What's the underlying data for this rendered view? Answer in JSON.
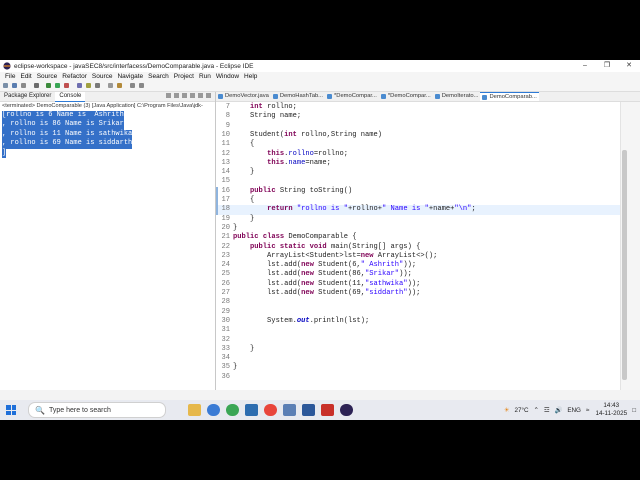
{
  "window": {
    "title": "eclipse-workspace - javaSEC8/src/interfacess/DemoComparable.java - Eclipse IDE",
    "controls": [
      "–",
      "❐",
      "✕"
    ]
  },
  "menu": [
    "File",
    "Edit",
    "Source",
    "Refactor",
    "Source",
    "Navigate",
    "Search",
    "Project",
    "Run",
    "Window",
    "Help"
  ],
  "left_panel": {
    "tabs": [
      "Package Explorer",
      "Console"
    ],
    "console_header": "<terminated> DemoComparable (3) [Java Application] C:\\Program Files\\Java\\jdk-",
    "console_lines": [
      "[rollno is 6 Name is  Ashrith",
      ", rollno is 86 Name is Srikar",
      ", rollno is 11 Name is sathwika",
      ", rollno is 69 Name is siddarth"
    ],
    "console_end": "]"
  },
  "editor_tabs": [
    "DemoVector.java",
    "DemoHashTab...",
    "*DemoCompar...",
    "*DemoCompar...",
    "DemoIterato...",
    "DemoComparab..."
  ],
  "code": {
    "lines": [
      {
        "n": "7",
        "parts": [
          [
            "    ",
            ""
          ],
          [
            "int",
            "kw"
          ],
          [
            " rollno;",
            ""
          ]
        ]
      },
      {
        "n": "8",
        "parts": [
          [
            "    String name;",
            ""
          ]
        ]
      },
      {
        "n": "9",
        "parts": [
          [
            "",
            ""
          ]
        ]
      },
      {
        "n": "10",
        "parts": [
          [
            "    Student(",
            ""
          ],
          [
            "int",
            "kw"
          ],
          [
            " rollno,String name)",
            ""
          ]
        ]
      },
      {
        "n": "11",
        "parts": [
          [
            "    {",
            ""
          ]
        ]
      },
      {
        "n": "12",
        "parts": [
          [
            "        ",
            ""
          ],
          [
            "this",
            "kw"
          ],
          [
            ".",
            ""
          ],
          [
            "rollno",
            "fld"
          ],
          [
            "=rollno;",
            ""
          ]
        ]
      },
      {
        "n": "13",
        "parts": [
          [
            "        ",
            ""
          ],
          [
            "this",
            "kw"
          ],
          [
            ".",
            ""
          ],
          [
            "name",
            "fld"
          ],
          [
            "=name;",
            ""
          ]
        ]
      },
      {
        "n": "14",
        "parts": [
          [
            "    }",
            ""
          ]
        ]
      },
      {
        "n": "15",
        "parts": [
          [
            "",
            ""
          ]
        ]
      },
      {
        "n": "16",
        "parts": [
          [
            "    ",
            ""
          ],
          [
            "public",
            "kw"
          ],
          [
            " String toString()",
            ""
          ]
        ]
      },
      {
        "n": "17",
        "parts": [
          [
            "    {",
            ""
          ]
        ]
      },
      {
        "n": "18",
        "parts": [
          [
            "        ",
            ""
          ],
          [
            "return",
            "kw"
          ],
          [
            " ",
            ""
          ],
          [
            "\"rollno is \"",
            "str"
          ],
          [
            "+rollno+",
            ""
          ],
          [
            "\" Name is \"",
            "str"
          ],
          [
            "+name+",
            ""
          ],
          [
            "\"\\n\"",
            "str"
          ],
          [
            ";",
            ""
          ]
        ]
      },
      {
        "n": "19",
        "parts": [
          [
            "    }",
            ""
          ]
        ]
      },
      {
        "n": "20",
        "parts": [
          [
            "}",
            ""
          ]
        ]
      },
      {
        "n": "21",
        "parts": [
          [
            "public",
            "kw"
          ],
          [
            " ",
            ""
          ],
          [
            "class",
            "kw"
          ],
          [
            " DemoComparable {",
            ""
          ]
        ]
      },
      {
        "n": "22",
        "parts": [
          [
            "    ",
            ""
          ],
          [
            "public",
            "kw"
          ],
          [
            " ",
            ""
          ],
          [
            "static",
            "kw"
          ],
          [
            " ",
            ""
          ],
          [
            "void",
            "kw"
          ],
          [
            " main(String[] args) {",
            ""
          ]
        ]
      },
      {
        "n": "23",
        "parts": [
          [
            "        ArrayList<Student>lst=",
            ""
          ],
          [
            "new",
            "kw"
          ],
          [
            " ArrayList<>();",
            ""
          ]
        ]
      },
      {
        "n": "24",
        "parts": [
          [
            "        lst.add(",
            ""
          ],
          [
            "new",
            "kw"
          ],
          [
            " Student(6,",
            ""
          ],
          [
            "\" Ashrith\"",
            "str"
          ],
          [
            "));",
            ""
          ]
        ]
      },
      {
        "n": "25",
        "parts": [
          [
            "        lst.add(",
            ""
          ],
          [
            "new",
            "kw"
          ],
          [
            " Student(86,",
            ""
          ],
          [
            "\"Srikar\"",
            "str"
          ],
          [
            "));",
            ""
          ]
        ]
      },
      {
        "n": "26",
        "parts": [
          [
            "        lst.add(",
            ""
          ],
          [
            "new",
            "kw"
          ],
          [
            " Student(11,",
            ""
          ],
          [
            "\"sathwika\"",
            "str"
          ],
          [
            "));",
            ""
          ]
        ]
      },
      {
        "n": "27",
        "parts": [
          [
            "        lst.add(",
            ""
          ],
          [
            "new",
            "kw"
          ],
          [
            " Student(69,",
            ""
          ],
          [
            "\"siddarth\"",
            "str"
          ],
          [
            "));",
            ""
          ]
        ]
      },
      {
        "n": "28",
        "parts": [
          [
            "",
            ""
          ]
        ]
      },
      {
        "n": "29",
        "parts": [
          [
            "",
            ""
          ]
        ]
      },
      {
        "n": "30",
        "parts": [
          [
            "        System.",
            ""
          ],
          [
            "out",
            "sfld"
          ],
          [
            ".println(lst);",
            ""
          ]
        ]
      },
      {
        "n": "31",
        "parts": [
          [
            "",
            ""
          ]
        ]
      },
      {
        "n": "32",
        "parts": [
          [
            "",
            ""
          ]
        ]
      },
      {
        "n": "33",
        "parts": [
          [
            "    }",
            ""
          ]
        ]
      },
      {
        "n": "34",
        "parts": [
          [
            "",
            ""
          ]
        ]
      },
      {
        "n": "35",
        "parts": [
          [
            "}",
            ""
          ]
        ]
      },
      {
        "n": "36",
        "parts": [
          [
            "",
            ""
          ]
        ]
      }
    ],
    "current_line": "18"
  },
  "taskbar": {
    "search_placeholder": "Type here to search",
    "weather": "27°C",
    "language": "ENG",
    "time": "14:43",
    "date": "14-11-2025"
  },
  "colors": {
    "keyword": "#7f0055",
    "string": "#2a00ff",
    "field": "#0000c0",
    "selection": "#3470c8"
  }
}
